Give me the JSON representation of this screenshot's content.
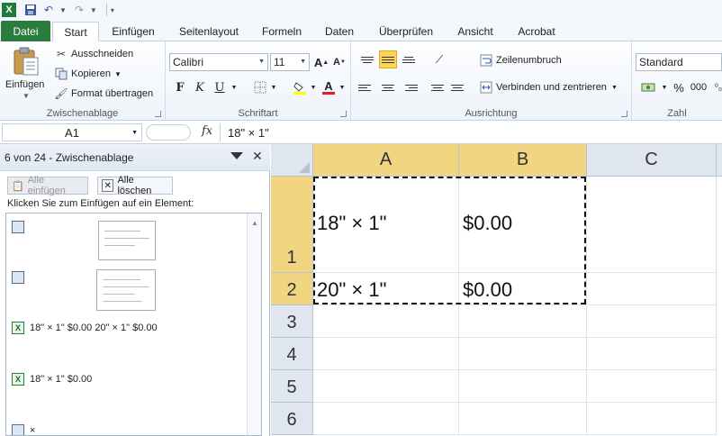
{
  "app": {
    "logo_letter": "X"
  },
  "tabs": [
    {
      "label": "Datei"
    },
    {
      "label": "Start"
    },
    {
      "label": "Einfügen"
    },
    {
      "label": "Seitenlayout"
    },
    {
      "label": "Formeln"
    },
    {
      "label": "Daten"
    },
    {
      "label": "Überprüfen"
    },
    {
      "label": "Ansicht"
    },
    {
      "label": "Acrobat"
    }
  ],
  "ribbon": {
    "clipboard": {
      "label": "Zwischenablage",
      "paste": "Einfügen",
      "cut": "Ausschneiden",
      "copy": "Kopieren",
      "format_painter": "Format übertragen"
    },
    "font": {
      "label": "Schriftart",
      "family": "Calibri",
      "size": "11"
    },
    "alignment": {
      "label": "Ausrichtung",
      "wrap": "Zeilenumbruch",
      "merge": "Verbinden und zentrieren"
    },
    "number": {
      "label": "Zahl",
      "format": "Standard"
    }
  },
  "formula_bar": {
    "name_box": "A1",
    "fx": "fx",
    "content": "18\" × 1\""
  },
  "clipboard_pane": {
    "title": "6 von 24 - Zwischenablage",
    "paste_all": "Alle einfügen",
    "clear_all": "Alle löschen",
    "hint": "Klicken Sie zum Einfügen auf ein Element:",
    "items": [
      {
        "type": "picture",
        "text": ""
      },
      {
        "type": "picture",
        "text": ""
      },
      {
        "type": "excel",
        "text": "18\" × 1\" $0.00 20\" × 1\" $0.00"
      },
      {
        "type": "excel",
        "text": "18\" × 1\" $0.00"
      },
      {
        "type": "excel",
        "text": "×"
      }
    ]
  },
  "sheet": {
    "columns": [
      "A",
      "B",
      "C"
    ],
    "rows": [
      "1",
      "2",
      "3",
      "4",
      "5",
      "6"
    ],
    "cells": {
      "A1": "18\" × 1\"",
      "B1": "$0.00",
      "A2": "20\" × 1\"",
      "B2": "$0.00"
    }
  },
  "colors": {
    "file_tab": "#2a7d3c",
    "selection_header": "#f2d580",
    "accent": "#fbd55b"
  }
}
